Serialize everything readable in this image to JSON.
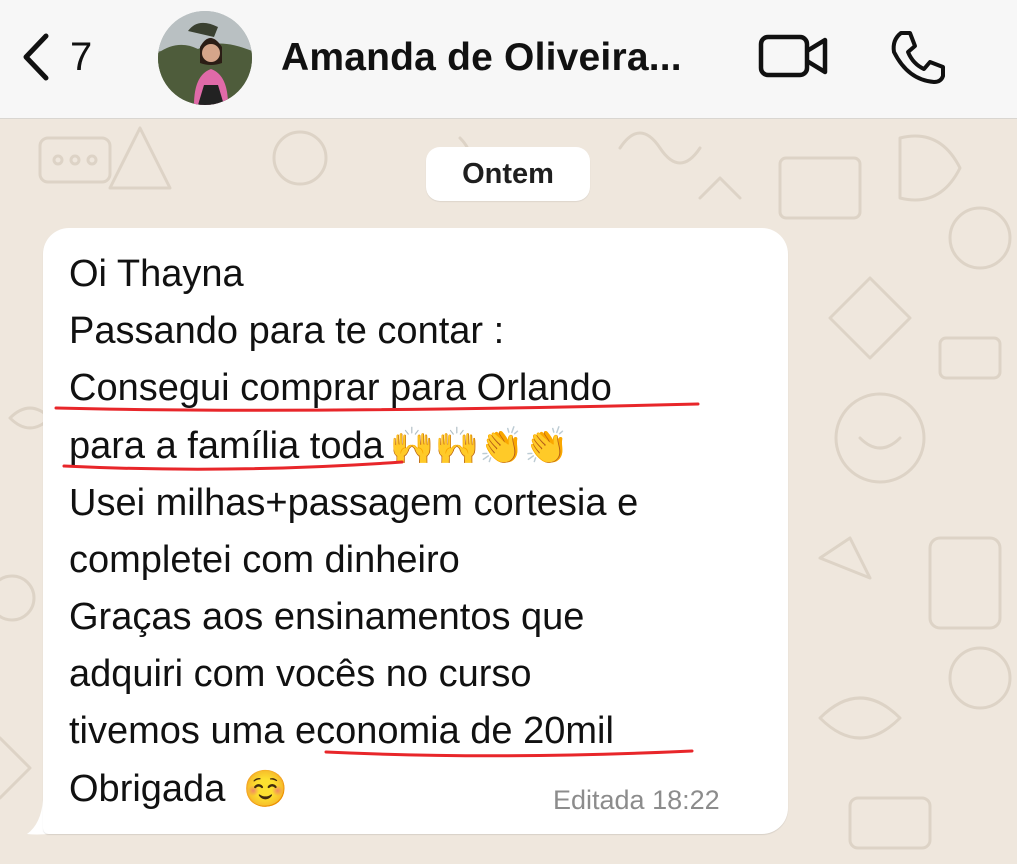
{
  "header": {
    "back_count": "7",
    "contact_name": "Amanda de Oliveira...",
    "icons": [
      "chevron-left-icon",
      "video-camera-icon",
      "phone-icon"
    ]
  },
  "chat": {
    "date_separator": "Ontem",
    "message": {
      "lines": [
        "Oi Thayna",
        "Passando para te contar :",
        "Consegui comprar para Orlando",
        "para a família toda",
        "Usei milhas+passagem cortesia e",
        "completei com dinheiro",
        "Graças aos ensinamentos que",
        "adquiri com vocês no curso",
        "tivemos uma",
        "economia de 20mil",
        "Obrigada"
      ],
      "emojis_line4": "🙌🙌👏👏",
      "emoji_last": "☺️",
      "edited_label": "Editada",
      "time": "18:22"
    }
  },
  "colors": {
    "wallpaper": "#efe7dd",
    "bubble": "#ffffff",
    "header": "#f7f7f7",
    "highlight_underline": "#e8262a"
  }
}
